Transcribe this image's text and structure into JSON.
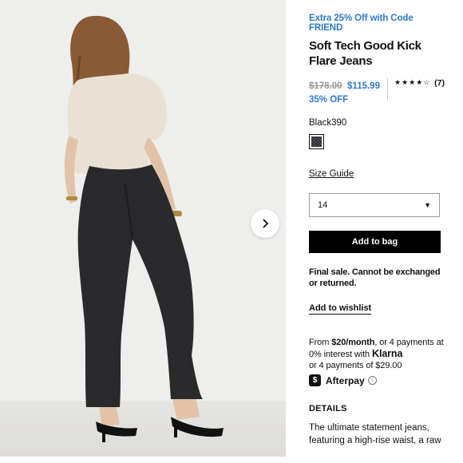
{
  "product": {
    "promo": "Extra 25% Off with Code FRIEND",
    "title": "Soft Tech Good Kick Flare Jeans",
    "price_original": "$178.00",
    "price_sale": "$115.99",
    "discount": "35% OFF",
    "rating_stars": "★★★★☆",
    "rating_count": "(7)",
    "color_name": "Black390",
    "size_guide_label": "Size Guide",
    "size_selected": "14",
    "add_to_bag_label": "Add to bag",
    "final_sale_note": "Final sale. Cannot be exchanged or returned.",
    "wishlist_label": "Add to wishlist"
  },
  "payment": {
    "klarna_prefix": "From ",
    "klarna_amount": "$20/month",
    "klarna_suffix": ", or 4 payments at 0% interest with ",
    "klarna_brand": "Klarna",
    "afterpay_text": "or 4 payments of $29.00",
    "afterpay_brand": "Afterpay",
    "afterpay_badge": "$"
  },
  "details": {
    "heading": "DETAILS",
    "body": "The ultimate statement jeans, featuring a high-rise waist, a raw"
  },
  "colors": {
    "accent": "#2f7ac9",
    "button_bg": "#000000"
  },
  "icons": {
    "next": "chevron-right-icon",
    "caret": "▼",
    "info": "i"
  }
}
